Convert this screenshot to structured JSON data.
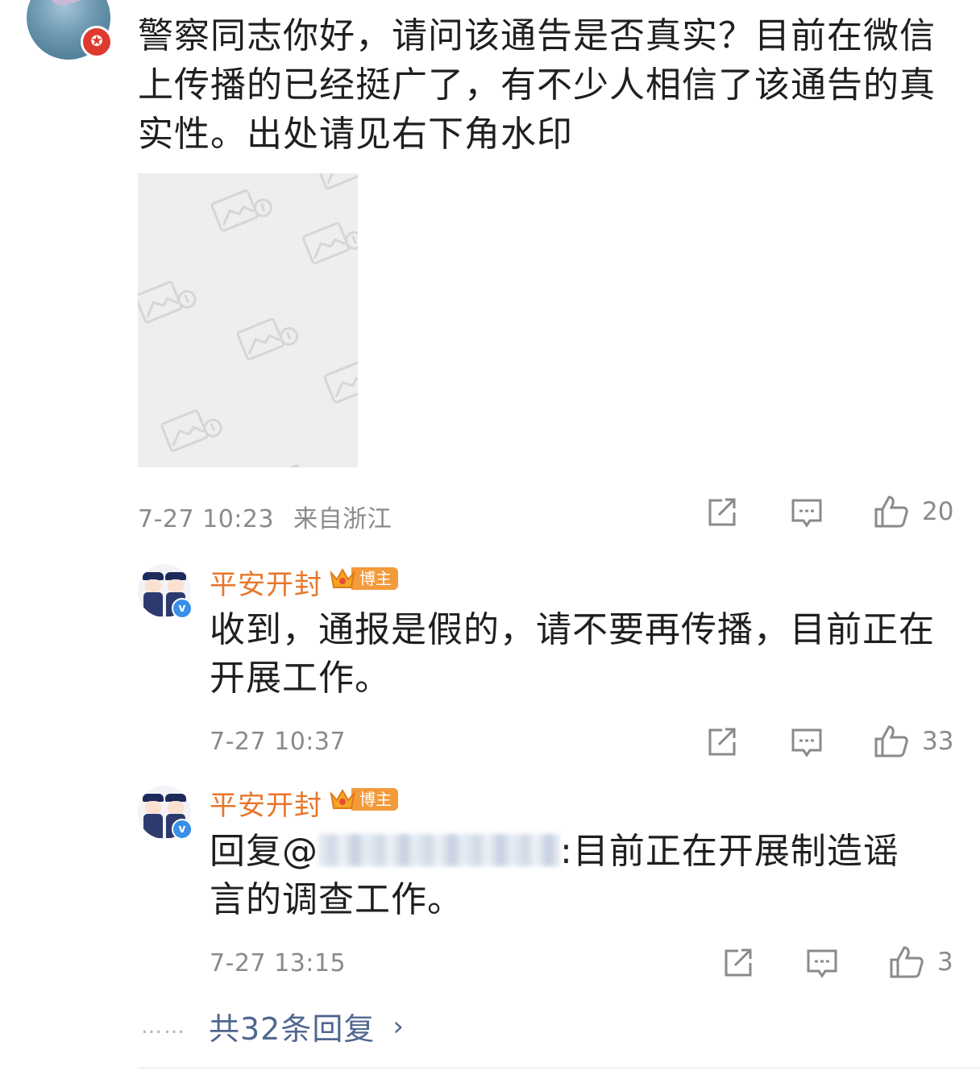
{
  "main_comment": {
    "text": "警察同志你好，请问该通告是否真实？目前在微信上传播的已经挺广了，有不少人相信了该通告的真实性。出处请见右下角水印",
    "time": "7-27 10:23",
    "location": "来自浙江",
    "likes": "20"
  },
  "replies": [
    {
      "name": "平安开封",
      "badge": "博主",
      "text": "收到，通报是假的，请不要再传播，目前正在开展工作。",
      "time": "7-27 10:37",
      "likes": "33"
    },
    {
      "name": "平安开封",
      "badge": "博主",
      "prefix": "回复@",
      "suffix": ":目前正在开展制造谣言的调查工作。",
      "time": "7-27 13:15",
      "likes": "3"
    }
  ],
  "footer": {
    "dots": "……",
    "more_label": "共32条回复",
    "arrow": "›"
  },
  "icons": {
    "share": "share-icon",
    "comment": "comment-icon",
    "like": "like-icon"
  },
  "colors": {
    "username": "#e8762a",
    "link": "#50678f",
    "meta": "#8a8a8a",
    "badge": "#f39a3a"
  }
}
